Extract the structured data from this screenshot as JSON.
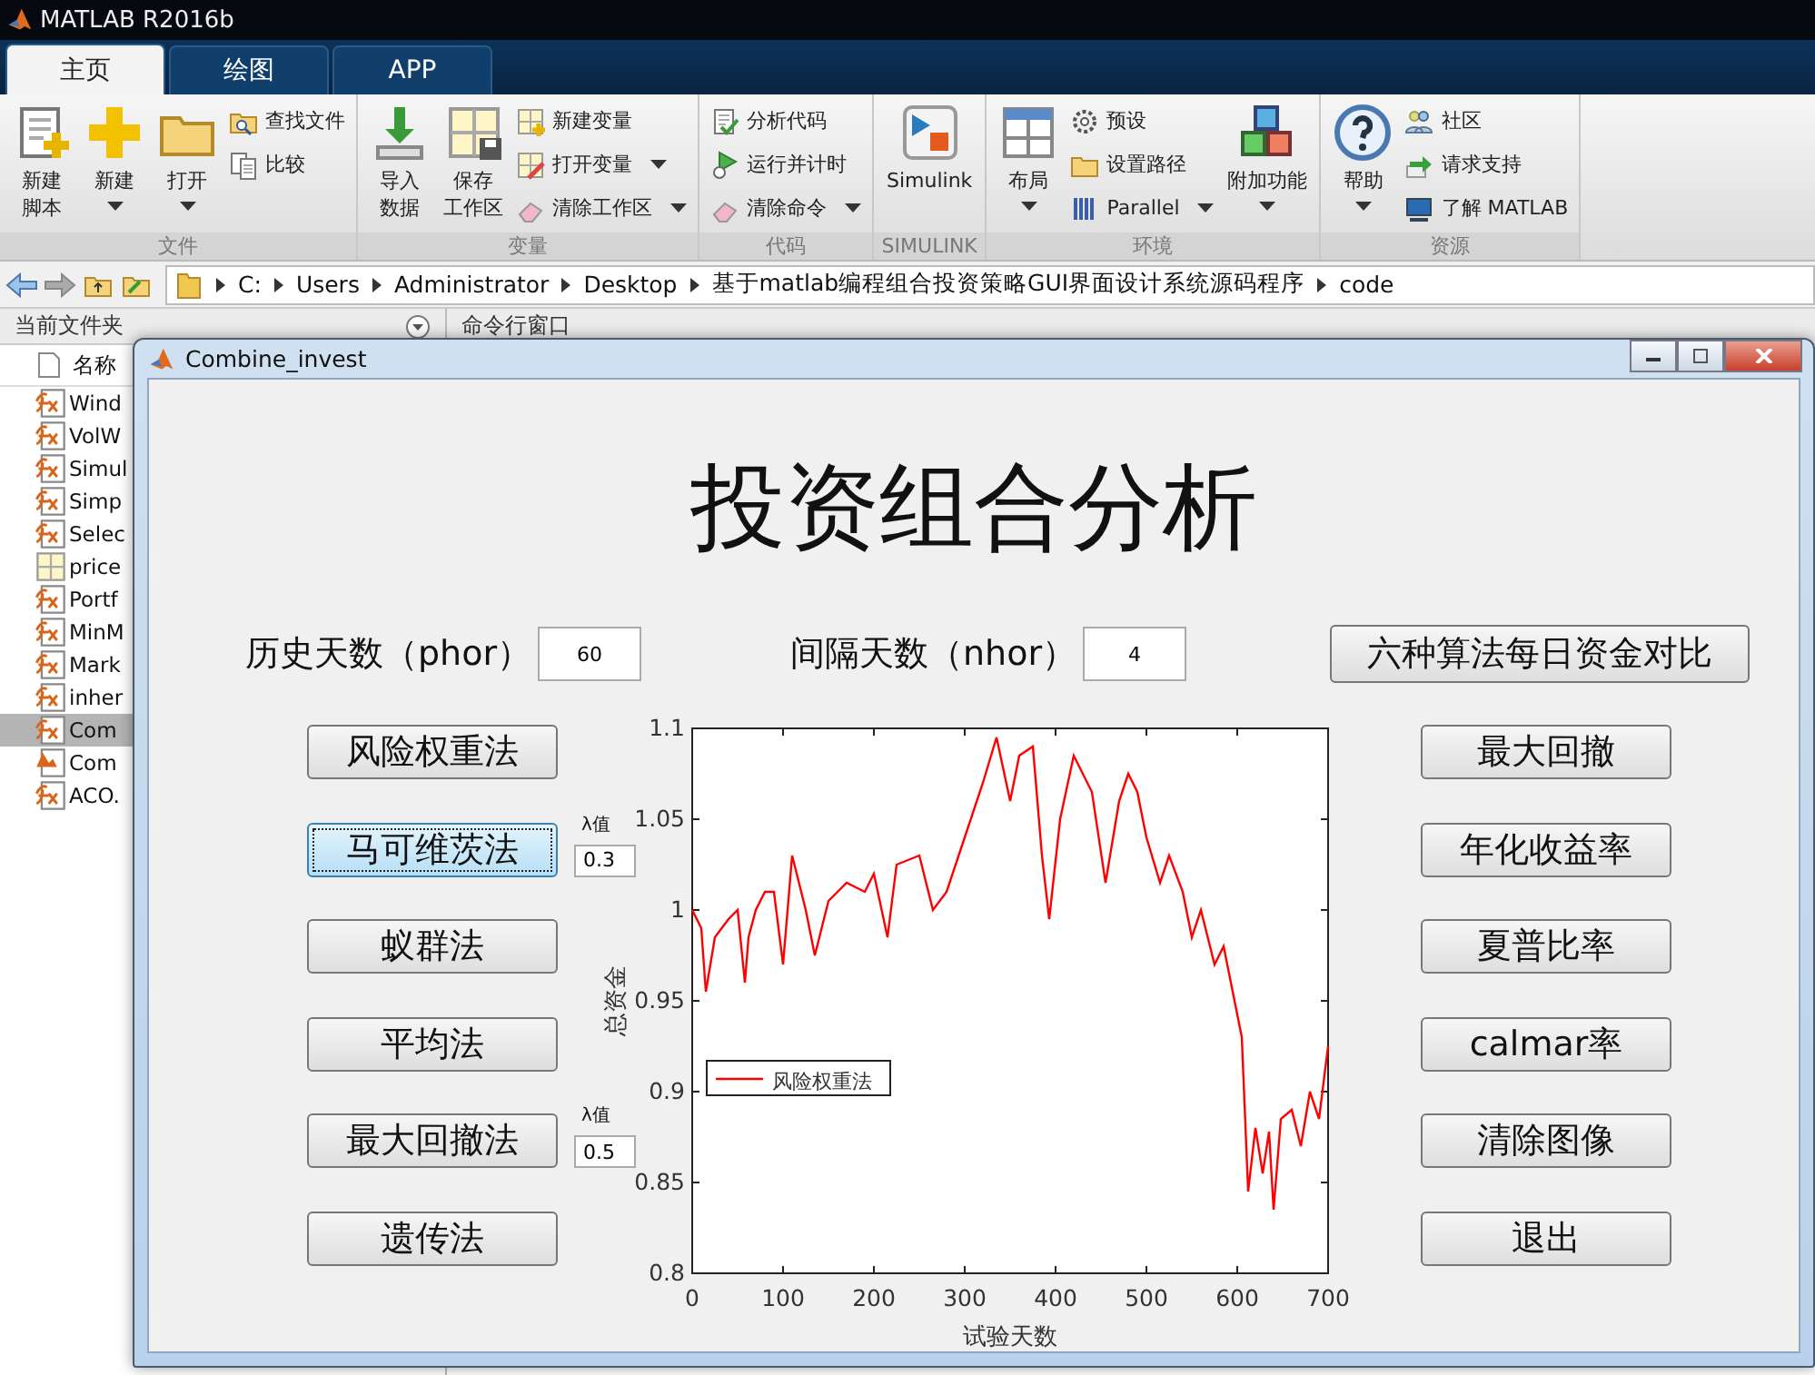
{
  "window": {
    "title": "MATLAB R2016b"
  },
  "tabs": [
    {
      "label": "主页",
      "selected": true
    },
    {
      "label": "绘图",
      "selected": false
    },
    {
      "label": "APP",
      "selected": false
    }
  ],
  "ribbon": [
    {
      "label": "文件",
      "columns": [
        {
          "kind": "large",
          "lines": [
            "新建",
            "脚本"
          ],
          "caret": false
        },
        {
          "kind": "large",
          "lines": [
            "新建"
          ],
          "caret": true
        },
        {
          "kind": "large",
          "lines": [
            "打开"
          ],
          "caret": true
        },
        {
          "kind": "stack",
          "items": [
            {
              "label": "查找文件",
              "caret": false
            },
            {
              "label": "比较",
              "caret": false
            }
          ]
        }
      ]
    },
    {
      "label": "变量",
      "columns": [
        {
          "kind": "large",
          "lines": [
            "导入",
            "数据"
          ],
          "caret": false
        },
        {
          "kind": "large",
          "lines": [
            "保存",
            "工作区"
          ],
          "caret": false
        },
        {
          "kind": "stack",
          "items": [
            {
              "label": "新建变量",
              "caret": false
            },
            {
              "label": "打开变量",
              "caret": true
            },
            {
              "label": "清除工作区",
              "caret": true
            }
          ]
        }
      ]
    },
    {
      "label": "代码",
      "columns": [
        {
          "kind": "stack",
          "items": [
            {
              "label": "分析代码",
              "caret": false
            },
            {
              "label": "运行并计时",
              "caret": false
            },
            {
              "label": "清除命令",
              "caret": true
            }
          ]
        }
      ]
    },
    {
      "label": "SIMULINK",
      "columns": [
        {
          "kind": "large",
          "lines": [
            "Simulink"
          ],
          "caret": false
        }
      ]
    },
    {
      "label": "环境",
      "columns": [
        {
          "kind": "large",
          "lines": [
            "布局"
          ],
          "caret": true
        },
        {
          "kind": "stack",
          "items": [
            {
              "label": "预设",
              "caret": false
            },
            {
              "label": "设置路径",
              "caret": false
            },
            {
              "label": "Parallel",
              "caret": true
            }
          ]
        },
        {
          "kind": "large",
          "lines": [
            "附加功能"
          ],
          "caret": true
        }
      ]
    },
    {
      "label": "资源",
      "columns": [
        {
          "kind": "large",
          "lines": [
            "帮助"
          ],
          "caret": true
        },
        {
          "kind": "stack",
          "items": [
            {
              "label": "社区",
              "caret": false
            },
            {
              "label": "请求支持",
              "caret": false
            },
            {
              "label": "了解 MATLAB",
              "caret": false
            }
          ]
        }
      ]
    }
  ],
  "path": {
    "segments": [
      "C:",
      "Users",
      "Administrator",
      "Desktop",
      "基于matlab编程组合投资策略GUI界面设计系统源码程序",
      "code"
    ]
  },
  "files_panel": {
    "title": "当前文件夹",
    "header": "名称",
    "items": [
      {
        "name": "Wind",
        "kind": "function",
        "selected": false
      },
      {
        "name": "VolW",
        "kind": "function",
        "selected": false
      },
      {
        "name": "Simul",
        "kind": "function",
        "selected": false
      },
      {
        "name": "Simp",
        "kind": "function",
        "selected": false
      },
      {
        "name": "Selec",
        "kind": "function",
        "selected": false
      },
      {
        "name": "price",
        "kind": "data",
        "selected": false
      },
      {
        "name": "Portf",
        "kind": "function",
        "selected": false
      },
      {
        "name": "MinM",
        "kind": "function",
        "selected": false
      },
      {
        "name": "Mark",
        "kind": "function",
        "selected": false
      },
      {
        "name": "inher",
        "kind": "function",
        "selected": false
      },
      {
        "name": "Com",
        "kind": "function",
        "selected": true
      },
      {
        "name": "Com",
        "kind": "figure",
        "selected": false
      },
      {
        "name": "ACO.",
        "kind": "function",
        "selected": false
      }
    ]
  },
  "command_panel": {
    "title": "命令行窗口"
  },
  "dialog": {
    "title": "Combine_invest",
    "heading": "投资组合分析",
    "params": [
      {
        "label": "历史天数（phor）",
        "value": "60"
      },
      {
        "label": "间隔天数（nhor）",
        "value": "4"
      }
    ],
    "compare_button": "六种算法每日资金对比",
    "methods": [
      {
        "label": "风险权重法",
        "focused": false
      },
      {
        "label": "马可维茨法",
        "focused": true,
        "param": {
          "label": "λ值",
          "value": "0.3"
        }
      },
      {
        "label": "蚁群法",
        "focused": false
      },
      {
        "label": "平均法",
        "focused": false
      },
      {
        "label": "最大回撤法",
        "focused": false,
        "param": {
          "label": "λ值",
          "value": "0.5"
        }
      },
      {
        "label": "遗传法",
        "focused": false
      }
    ],
    "metrics": [
      "最大回撤",
      "年化收益率",
      "夏普比率",
      "calmar率",
      "清除图像",
      "退出"
    ],
    "chart_data": {
      "type": "line",
      "xlabel": "试验天数",
      "ylabel": "总资金",
      "x": [
        0,
        10,
        15,
        25,
        40,
        50,
        58,
        62,
        70,
        80,
        90,
        100,
        110,
        125,
        135,
        150,
        170,
        190,
        200,
        215,
        225,
        250,
        265,
        280,
        300,
        320,
        335,
        350,
        360,
        375,
        385,
        393,
        405,
        420,
        440,
        455,
        470,
        480,
        490,
        500,
        515,
        525,
        540,
        550,
        560,
        575,
        585,
        595,
        605,
        612,
        620,
        628,
        635,
        640,
        648,
        660,
        670,
        680,
        690,
        700
      ],
      "series": [
        {
          "name": "风险权重法",
          "color": "#ff0000",
          "values": [
            1.0,
            0.99,
            0.955,
            0.985,
            0.995,
            1.0,
            0.96,
            0.985,
            1.0,
            1.01,
            1.01,
            0.97,
            1.03,
            1.0,
            0.975,
            1.005,
            1.015,
            1.01,
            1.02,
            0.985,
            1.025,
            1.03,
            1.0,
            1.01,
            1.04,
            1.07,
            1.095,
            1.06,
            1.085,
            1.09,
            1.03,
            0.995,
            1.05,
            1.085,
            1.065,
            1.015,
            1.06,
            1.075,
            1.065,
            1.04,
            1.015,
            1.03,
            1.01,
            0.985,
            1.0,
            0.97,
            0.98,
            0.955,
            0.93,
            0.845,
            0.88,
            0.855,
            0.878,
            0.835,
            0.885,
            0.89,
            0.87,
            0.9,
            0.885,
            0.925
          ]
        }
      ],
      "xlim": [
        0,
        700
      ],
      "ylim": [
        0.8,
        1.1
      ],
      "xticks": [
        0,
        100,
        200,
        300,
        400,
        500,
        600,
        700
      ],
      "yticks": [
        0.8,
        0.85,
        0.9,
        0.95,
        1,
        1.05,
        1.1
      ]
    }
  }
}
